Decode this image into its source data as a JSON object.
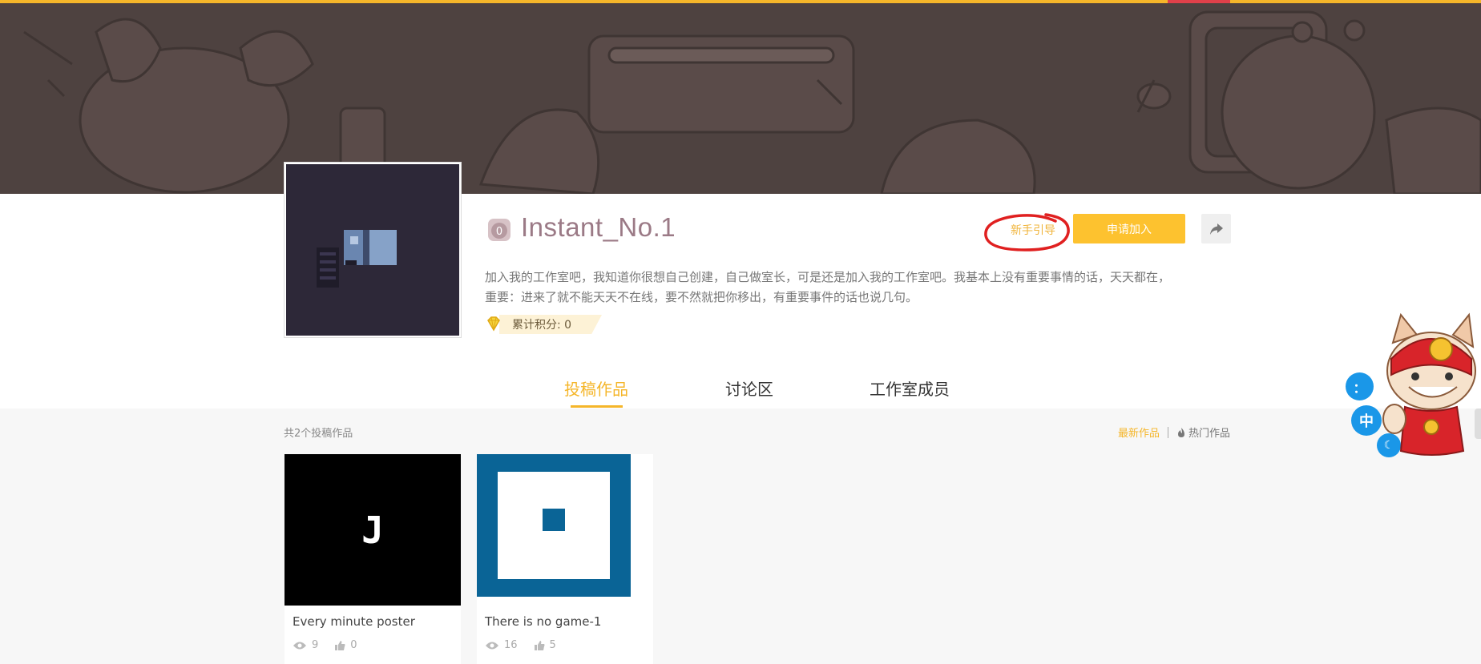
{
  "studio": {
    "title": "Instant_No.1",
    "badge_text": "0",
    "description_line1": "加入我的工作室吧，我知道你很想自己创建，自己做室长，可是还是加入我的工作室吧。我基本上没有重要事情的话，天天都在，",
    "description_line2": "重要：进来了就不能天天不在线，要不然就把你移出，有重要事件的话也说几句。",
    "score_label": "累计积分: 0"
  },
  "actions": {
    "guide_label": "新手引导",
    "join_label": "申请加入",
    "share_icon": "share-icon"
  },
  "tabs": [
    {
      "label": "投稿作品",
      "active": true
    },
    {
      "label": "讨论区",
      "active": false
    },
    {
      "label": "工作室成员",
      "active": false
    }
  ],
  "works": {
    "count_label": "共2个投稿作品",
    "sort_newest": "最新作品",
    "sort_hot": "热门作品",
    "items": [
      {
        "title": "Every minute poster",
        "views": "9",
        "likes": "0",
        "thumb_letter": "J"
      },
      {
        "title": "There is no game-1",
        "views": "16",
        "likes": "5"
      }
    ]
  },
  "floating": {
    "btn_top": "：",
    "btn_mid": "中",
    "btn_bottom": "☾"
  },
  "colors": {
    "accent": "#f5b62a",
    "join_button": "#fdc22f",
    "banner": "#4e4240",
    "title": "#9b7a86",
    "float_button": "#1a97e8",
    "guide_circle": "#e02020"
  }
}
